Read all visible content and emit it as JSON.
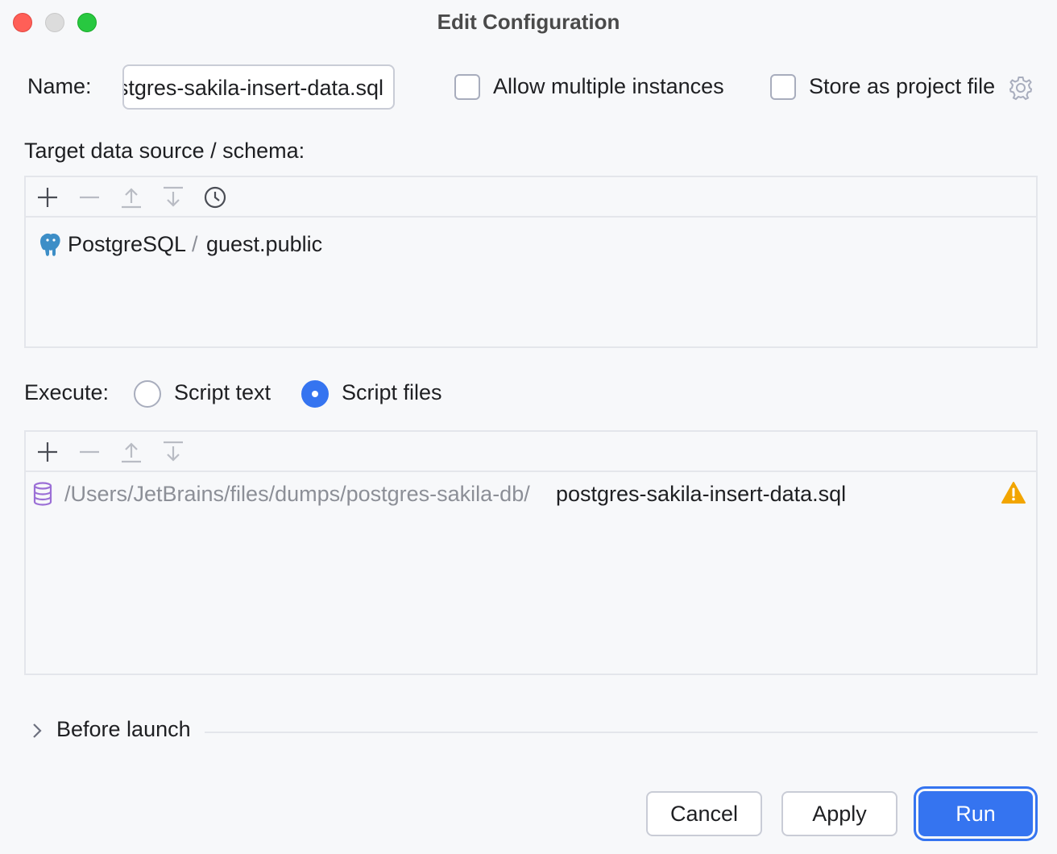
{
  "window": {
    "title": "Edit Configuration"
  },
  "name": {
    "label": "Name:",
    "value": "postgres-sakila-insert-data.sql",
    "displayed_value": "res-sakila-insert-data.sql"
  },
  "options": {
    "allow_multiple": {
      "label": "Allow multiple instances",
      "checked": false
    },
    "store_project_file": {
      "label": "Store as project file",
      "checked": false
    }
  },
  "target": {
    "label": "Target data source / schema:",
    "toolbar": [
      "add-icon",
      "remove-icon",
      "move-up-icon",
      "move-down-icon",
      "history-icon"
    ],
    "items": [
      {
        "source": "PostgreSQL",
        "separator": "/",
        "schema": "guest.public",
        "icon": "postgresql-icon"
      }
    ]
  },
  "execute": {
    "label": "Execute:",
    "options": [
      {
        "label": "Script text",
        "selected": false
      },
      {
        "label": "Script files",
        "selected": true
      }
    ]
  },
  "files": {
    "toolbar": [
      "add-icon",
      "remove-icon",
      "move-up-icon",
      "move-down-icon"
    ],
    "items": [
      {
        "dir": "/Users/JetBrains/files/dumps/postgres-sakila-db/",
        "file": "postgres-sakila-insert-data.sql",
        "icon": "database-icon",
        "status_icon": "warning-icon"
      }
    ]
  },
  "before_launch": {
    "label": "Before launch",
    "expanded": false
  },
  "buttons": {
    "cancel": "Cancel",
    "apply": "Apply",
    "run": "Run"
  },
  "colors": {
    "accent": "#3574f0",
    "warning": "#f2a500",
    "db_icon": "#9b6fd6",
    "pg_icon": "#3d8ec7"
  }
}
